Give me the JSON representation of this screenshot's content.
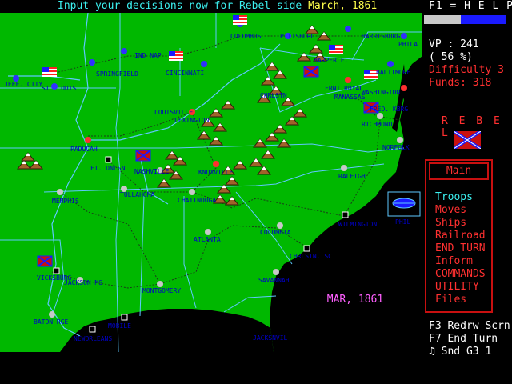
{
  "top_bar": {
    "prefix": "Input your decisions now for Rebel side ",
    "date": "March, 1861"
  },
  "side": {
    "help": "F1 = H E L P",
    "progress_fraction": 0.45,
    "vp": "VP : 241",
    "pct": "( 56 %)",
    "difficulty": "Difficulty 3",
    "funds": "Funds: 318",
    "side_name": "R E B E L",
    "menu_title": "Main",
    "menu": [
      "Troops",
      "Moves",
      "Ships",
      "Railroad",
      "END TURN",
      "Inform",
      "COMMANDS",
      "UTILITY",
      "Files"
    ],
    "fkeys": [
      "F3 Redrw Scrn",
      "F7 End Turn",
      "♫ Snd G3 1"
    ]
  },
  "map": {
    "date_box": "MAR, 1861",
    "cities": [
      "COLUMBUS",
      "PITTSBURG",
      "HARRISBURG",
      "PHILA",
      "IND NAP",
      "SPRINGFIELD",
      "CINCINNATI",
      "JEFF. CITY",
      "ST. LOUIS",
      "HARPER F.",
      "BALTIMORE",
      "FRNT ROYAL",
      "MANASSAS",
      "WASHINGTON",
      "CHRLSTN",
      "LOUISVILLE",
      "LEXINGTON",
      "FRED. KBRG",
      "RICHMOND",
      "PADUCAH",
      "FT. DNLSN",
      "NASHVILLE",
      "KNOXVILLE",
      "NORFOLK",
      "MEMPHIS",
      "TULLAHOMA",
      "CHATTNOOGA",
      "RALEIGH",
      "PHIL",
      "WILMINGTON",
      "COLUMBIA",
      "ATLANTA",
      "CHRLSTN. SC",
      "VICKSBURG",
      "JACKSON MS",
      "MONTGOMERY",
      "SAVANNAH",
      "BATON RGE",
      "MOBILE",
      "NEWORLEANS",
      "JACKSNVIL"
    ]
  },
  "colors": {
    "land": "#00b800",
    "sea": "#000000",
    "line": "#5ec8ff",
    "rail": "#282828",
    "rebel": "#c81010",
    "union_blue": "#1a1aff"
  }
}
